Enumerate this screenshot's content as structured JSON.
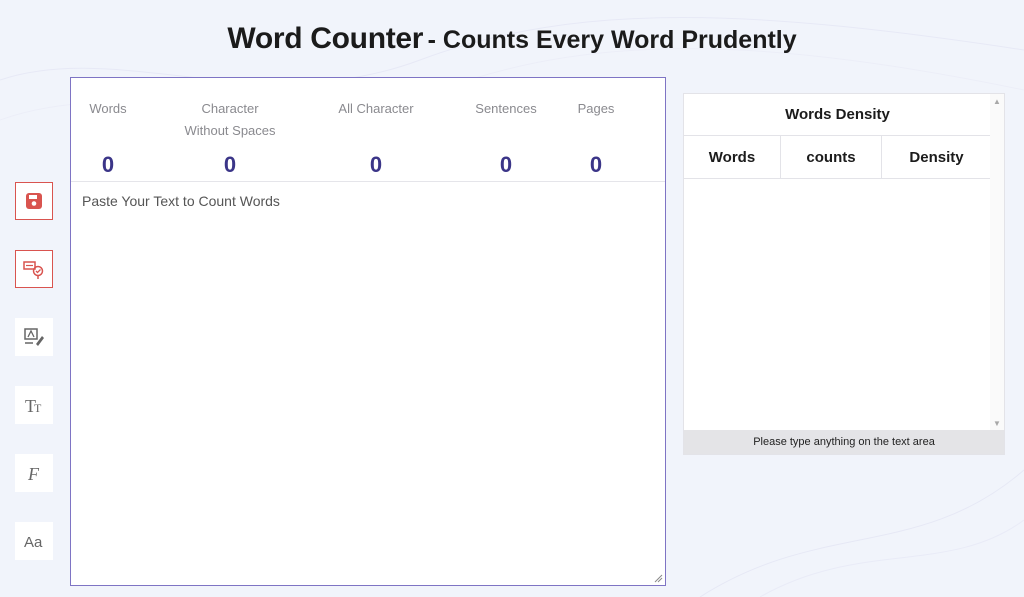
{
  "header": {
    "title": "Word Counter",
    "subtitle": "- Counts Every Word Prudently"
  },
  "toolbar": {
    "tools": [
      {
        "name": "save-icon",
        "active": true
      },
      {
        "name": "spell-check-icon",
        "active": true
      },
      {
        "name": "text-edit-icon",
        "active": false
      },
      {
        "name": "text-size-icon",
        "active": false
      },
      {
        "name": "font-style-icon",
        "active": false
      },
      {
        "name": "case-change-icon",
        "active": false
      }
    ]
  },
  "stats": {
    "words": {
      "label": "Words",
      "value": "0"
    },
    "char_no_spaces": {
      "label_line1": "Character",
      "label_line2": "Without Spaces",
      "value": "0"
    },
    "all_char": {
      "label": "All Character",
      "value": "0"
    },
    "sentences": {
      "label": "Sentences",
      "value": "0"
    },
    "pages": {
      "label": "Pages",
      "value": "0"
    }
  },
  "editor": {
    "placeholder": "Paste Your Text to Count Words",
    "value": ""
  },
  "density": {
    "title": "Words Density",
    "columns": [
      "Words",
      "counts",
      "Density"
    ],
    "footer": "Please type anything on the text area"
  },
  "colors": {
    "accent": "#3b3588",
    "border": "#7e74c4",
    "tool_active": "#d9544f",
    "background": "#f1f4fb"
  }
}
